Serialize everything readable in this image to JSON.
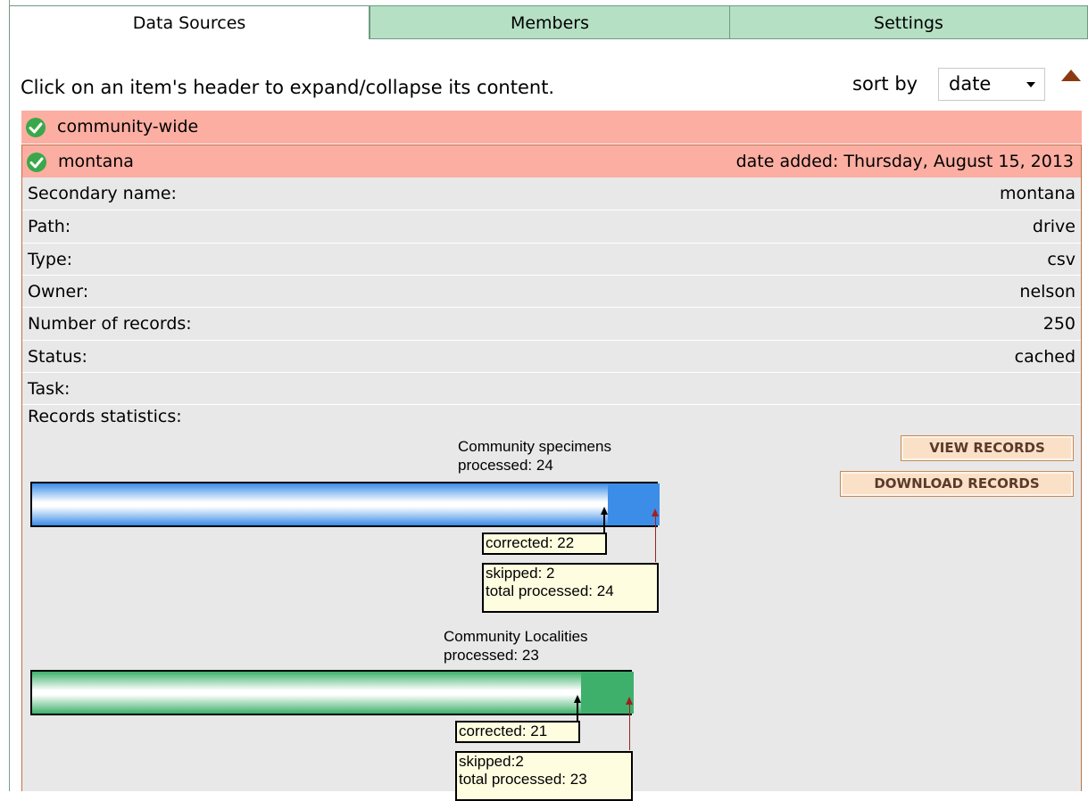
{
  "tabs": [
    {
      "label": "Data Sources",
      "active": true
    },
    {
      "label": "Members",
      "active": false
    },
    {
      "label": "Settings",
      "active": false
    }
  ],
  "intro_text": "Click on an item's header to expand/collapse its content.",
  "sort": {
    "label": "sort by",
    "selected": "date"
  },
  "items": [
    {
      "title": "community-wide",
      "expanded": false
    },
    {
      "title": "montana",
      "date_added": "date added: Thursday, August 15, 2013",
      "expanded": true
    }
  ],
  "details": {
    "rows": [
      {
        "label": "Secondary name:",
        "value": "montana"
      },
      {
        "label": "Path:",
        "value": "drive"
      },
      {
        "label": "Type:",
        "value": "csv"
      },
      {
        "label": "Owner:",
        "value": "nelson"
      },
      {
        "label": "Number of records:",
        "value": "250"
      },
      {
        "label": "Status:",
        "value": "cached"
      },
      {
        "label": "Task:",
        "value": ""
      }
    ],
    "stats_label": "Records statistics:",
    "view_button": "VIEW RECORDS",
    "download_button": "DOWNLOAD RECORDS"
  },
  "stats": [
    {
      "title": "Community specimens",
      "processed_label": "processed: 24",
      "processed": 24,
      "corrected": 22,
      "skipped": 2,
      "corrected_label": "corrected: 22",
      "skipped_label": "skipped: 2",
      "total_label": "total processed: 24",
      "color": "#3b8de8"
    },
    {
      "title": "Community Localities",
      "processed_label": "processed: 23",
      "processed": 23,
      "corrected": 21,
      "skipped": 2,
      "corrected_label": "corrected: 21",
      "skipped_label": "skipped:2",
      "total_label": "total processed: 23",
      "color": "#3fb06c"
    }
  ],
  "colors": {
    "tab_inactive": "#b5e0c4",
    "item_header": "#fcaea2",
    "details_bg": "#e8e8e8",
    "button_bg": "#fbe0c8"
  }
}
